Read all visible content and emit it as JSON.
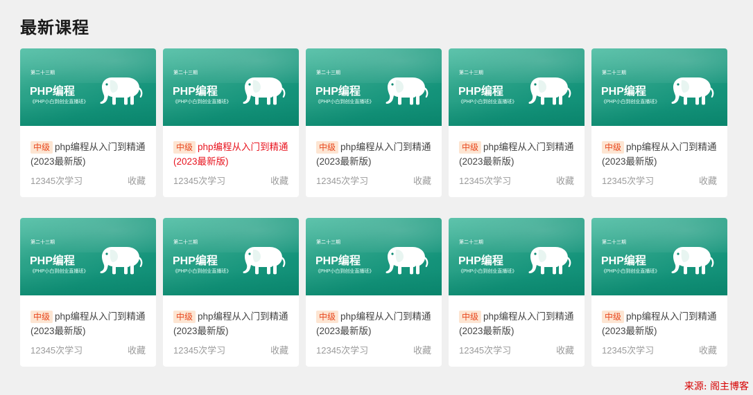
{
  "page": {
    "title": "最新课程"
  },
  "courses": [
    {
      "period": "第二十三期",
      "cover_title": "PHP编程",
      "cover_subtitle": "《PHP小白到创业直播班》",
      "level": "中级",
      "name": "php编程从入门到精通(2023最新版)",
      "learners": "12345次学习",
      "favorite": "收藏",
      "active": false
    },
    {
      "period": "第二十三期",
      "cover_title": "PHP编程",
      "cover_subtitle": "《PHP小白到创业直播班》",
      "level": "中级",
      "name": "php编程从入门到精通(2023最新版)",
      "learners": "12345次学习",
      "favorite": "收藏",
      "active": true
    },
    {
      "period": "第二十三期",
      "cover_title": "PHP编程",
      "cover_subtitle": "《PHP小白到创业直播班》",
      "level": "中级",
      "name": "php编程从入门到精通(2023最新版)",
      "learners": "12345次学习",
      "favorite": "收藏",
      "active": false
    },
    {
      "period": "第二十三期",
      "cover_title": "PHP编程",
      "cover_subtitle": "《PHP小白到创业直播班》",
      "level": "中级",
      "name": "php编程从入门到精通(2023最新版)",
      "learners": "12345次学习",
      "favorite": "收藏",
      "active": false
    },
    {
      "period": "第二十三期",
      "cover_title": "PHP编程",
      "cover_subtitle": "《PHP小白到创业直播班》",
      "level": "中级",
      "name": "php编程从入门到精通(2023最新版)",
      "learners": "12345次学习",
      "favorite": "收藏",
      "active": false
    },
    {
      "period": "第二十三期",
      "cover_title": "PHP编程",
      "cover_subtitle": "《PHP小白到创业直播班》",
      "level": "中级",
      "name": "php编程从入门到精通(2023最新版)",
      "learners": "12345次学习",
      "favorite": "收藏",
      "active": false
    },
    {
      "period": "第二十三期",
      "cover_title": "PHP编程",
      "cover_subtitle": "《PHP小白到创业直播班》",
      "level": "中级",
      "name": "php编程从入门到精通(2023最新版)",
      "learners": "12345次学习",
      "favorite": "收藏",
      "active": false
    },
    {
      "period": "第二十三期",
      "cover_title": "PHP编程",
      "cover_subtitle": "《PHP小白到创业直播班》",
      "level": "中级",
      "name": "php编程从入门到精通(2023最新版)",
      "learners": "12345次学习",
      "favorite": "收藏",
      "active": false
    },
    {
      "period": "第二十三期",
      "cover_title": "PHP编程",
      "cover_subtitle": "《PHP小白到创业直播班》",
      "level": "中级",
      "name": "php编程从入门到精通(2023最新版)",
      "learners": "12345次学习",
      "favorite": "收藏",
      "active": false
    },
    {
      "period": "第二十三期",
      "cover_title": "PHP编程",
      "cover_subtitle": "《PHP小白到创业直播班》",
      "level": "中级",
      "name": "php编程从入门到精通(2023最新版)",
      "learners": "12345次学习",
      "favorite": "收藏",
      "active": false
    }
  ],
  "watermark": "来源: 阁主博客",
  "colors": {
    "background": "#f0f0f0",
    "cover": "#14937a",
    "tag_bg": "#fde5d2",
    "tag_text": "#e8471d",
    "active_text": "#e8141f",
    "muted": "#9a9a9a"
  },
  "icons": {
    "cover_mascot": "elephant-icon"
  }
}
